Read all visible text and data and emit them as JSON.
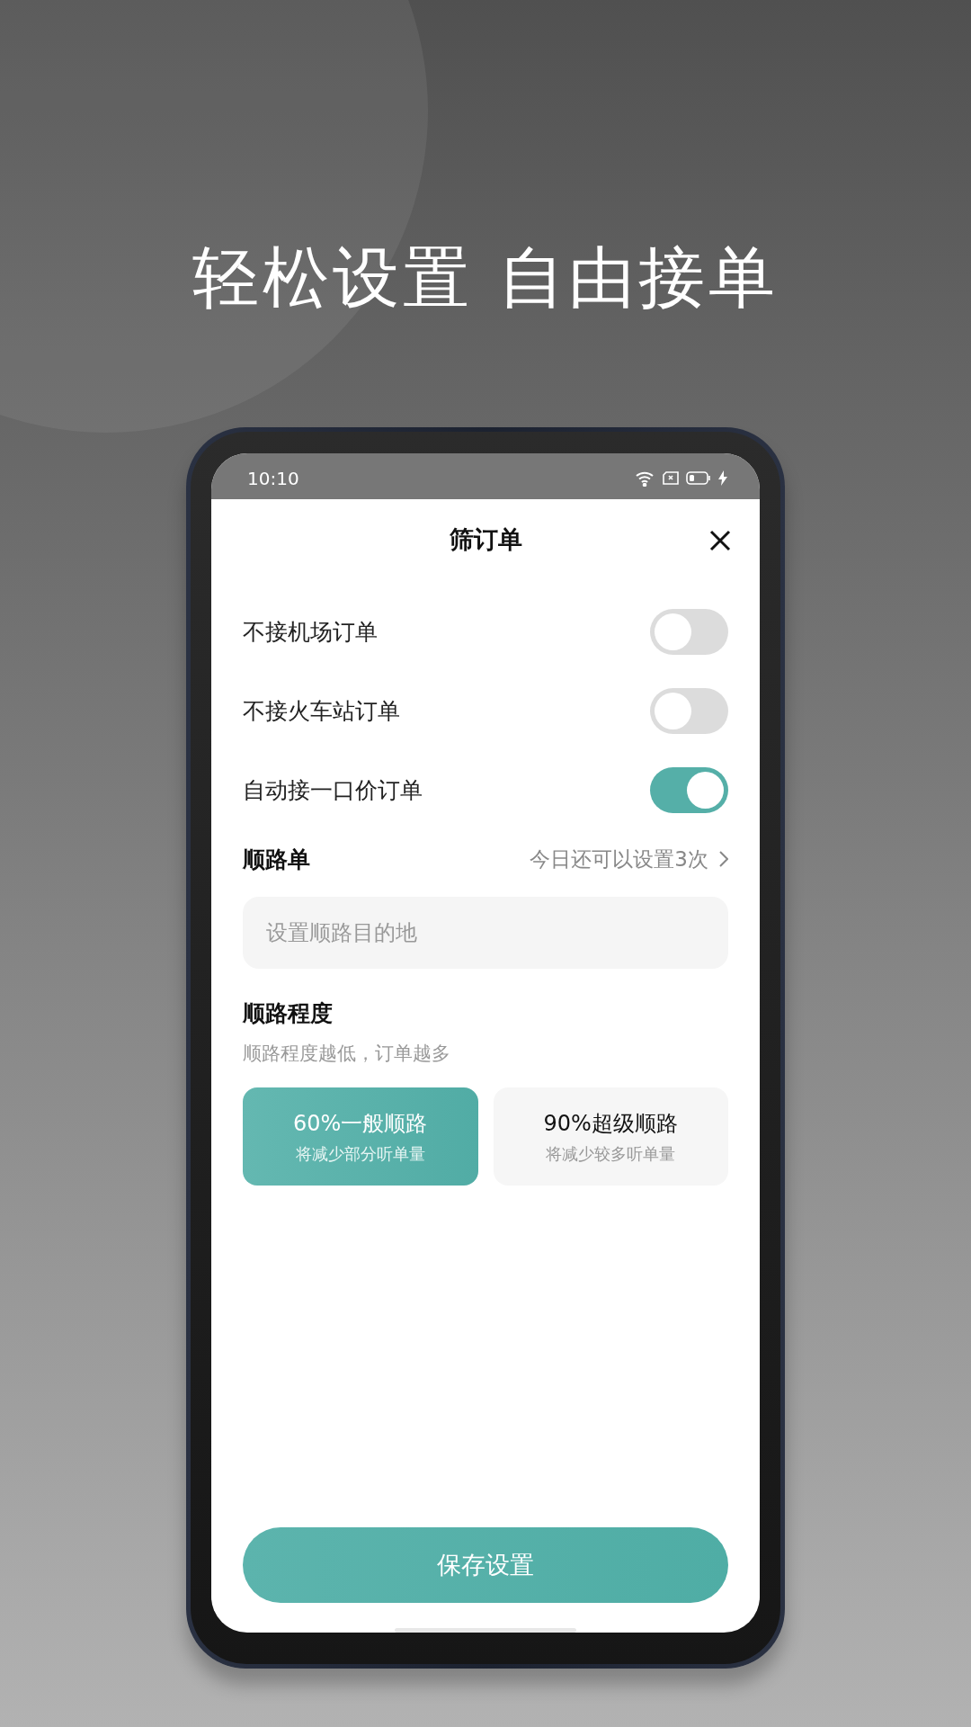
{
  "headline": "轻松设置 自由接单",
  "status_bar": {
    "time": "10:10"
  },
  "sheet": {
    "title": "筛订单"
  },
  "toggles": [
    {
      "label": "不接机场订单",
      "on": false
    },
    {
      "label": "不接火车站订单",
      "on": false
    },
    {
      "label": "自动接一口价订单",
      "on": true
    }
  ],
  "route": {
    "label": "顺路单",
    "remaining": "今日还可以设置3次",
    "placeholder": "设置顺路目的地"
  },
  "degree": {
    "title": "顺路程度",
    "hint": "顺路程度越低，订单越多",
    "options": [
      {
        "title": "60%一般顺路",
        "subtitle": "将减少部分听单量",
        "selected": true
      },
      {
        "title": "90%超级顺路",
        "subtitle": "将减少较多听单量",
        "selected": false
      }
    ]
  },
  "save_button": "保存设置"
}
